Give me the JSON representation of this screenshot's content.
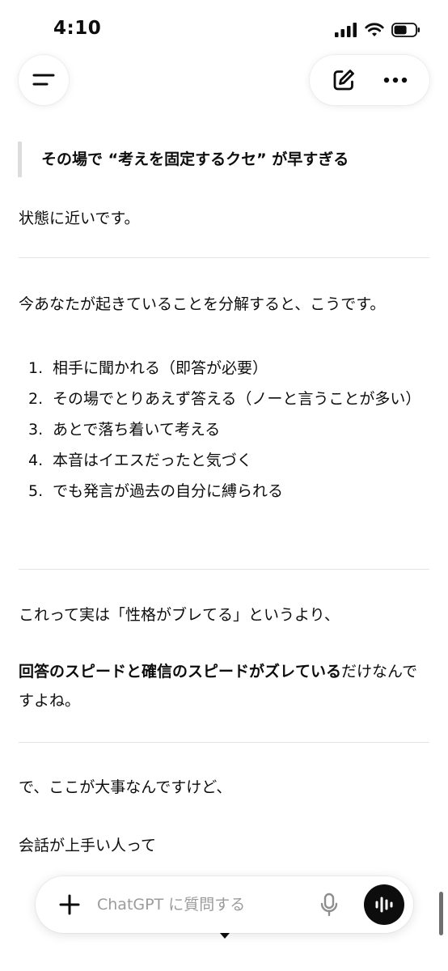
{
  "status_bar": {
    "time": "4:10"
  },
  "content": {
    "quote": "その場で “考えを固定するクセ” が早すぎる",
    "after_quote": "状態に近いです。",
    "intro": "今あなたが起きていることを分解すると、こうです。",
    "steps": [
      {
        "num": "1.",
        "text": "相手に聞かれる（即答が必要）"
      },
      {
        "num": "2.",
        "text": "その場でとりあえず答える（ノーと言うことが多い）"
      },
      {
        "num": "3.",
        "text": "あとで落ち着いて考える"
      },
      {
        "num": "4.",
        "text": "本音はイエスだったと気づく"
      },
      {
        "num": "5.",
        "text": "でも発言が過去の自分に縛られる"
      }
    ],
    "p3": "これって実は「性格がブレてる」というより、",
    "p4_bold": "回答のスピードと確信のスピードがズレている",
    "p4_rest": "だけなんですよね。",
    "p5": "で、ここが大事なんですけど、",
    "p6": "会話が上手い人って"
  },
  "input": {
    "placeholder": "ChatGPT に質問する"
  },
  "icons": {
    "menu": "menu-icon",
    "new_chat": "edit-icon",
    "more": "more-icon",
    "plus": "plus-icon",
    "mic": "mic-icon",
    "voice": "voice-waveform-icon",
    "scroll": "chevron-down-icon"
  },
  "colors": {
    "text": "#0d0d0d",
    "placeholder": "#9b9b9b",
    "divider": "#e3e3e3",
    "quote_bar": "#dcdcdc"
  }
}
